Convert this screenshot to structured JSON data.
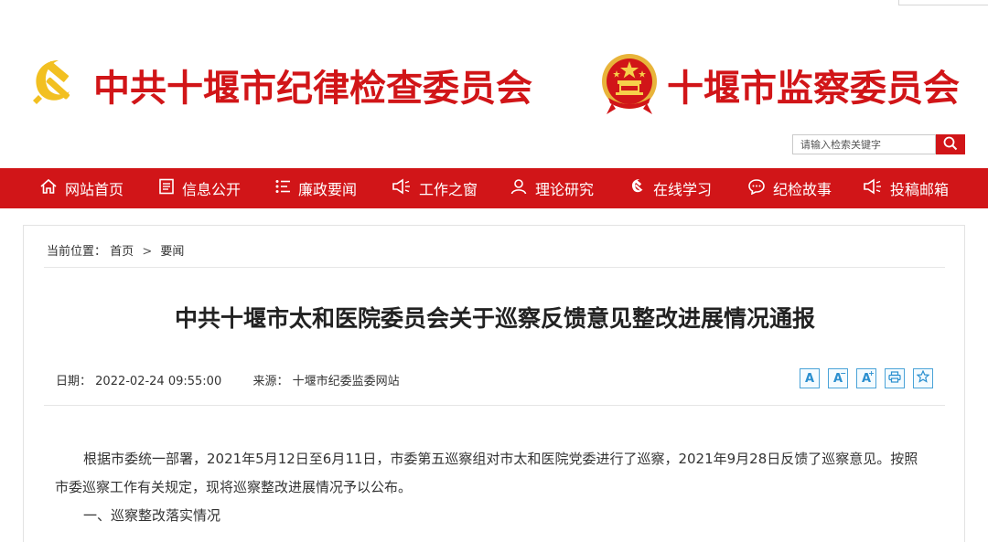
{
  "header": {
    "left_title": "中共十堰市纪律检查委员会",
    "right_title": "十堰市监察委员会",
    "left_emblem_icon": "party-emblem-icon",
    "right_emblem_icon": "national-emblem-icon",
    "brand_color": "#d11518"
  },
  "search": {
    "placeholder": "请输入检索关键字",
    "button_icon": "search-icon"
  },
  "nav": {
    "items": [
      {
        "label": "网站首页",
        "icon": "home-icon"
      },
      {
        "label": "信息公开",
        "icon": "document-icon"
      },
      {
        "label": "廉政要闻",
        "icon": "list-icon"
      },
      {
        "label": "工作之窗",
        "icon": "megaphone-icon"
      },
      {
        "label": "理论研究",
        "icon": "user-icon"
      },
      {
        "label": "在线学习",
        "icon": "party-emblem-icon"
      },
      {
        "label": "纪检故事",
        "icon": "chat-icon"
      },
      {
        "label": "投稿邮箱",
        "icon": "megaphone-icon"
      }
    ]
  },
  "breadcrumb": {
    "prefix": "当前位置：",
    "items": [
      "首页",
      "要闻"
    ],
    "separator": ">"
  },
  "article": {
    "title": "中共十堰市太和医院委员会关于巡察反馈意见整改进展情况通报",
    "date_label": "日期：",
    "date": "2022-02-24 09:55:00",
    "source_label": "来源：",
    "source": "十堰市纪委监委网站",
    "tools": [
      {
        "label": "A",
        "name": "font-default-icon"
      },
      {
        "label": "A",
        "name": "font-decrease-icon",
        "sup": "−"
      },
      {
        "label": "A",
        "name": "font-increase-icon",
        "sup": "+"
      },
      {
        "label": "",
        "name": "print-icon"
      },
      {
        "label": "",
        "name": "favorite-star-icon"
      }
    ],
    "paragraph_1_line_1": "根据市委统一部署，2021年5月12日至6月11日，市委第五巡察组对市太和医院党委进行了巡察，2021年9月28日反馈了巡察意见。按照",
    "paragraph_1_line_2": "市委巡察工作有关规定，现将巡察整改进展情况予以公布。",
    "section_1": "一、巡察整改落实情况"
  }
}
